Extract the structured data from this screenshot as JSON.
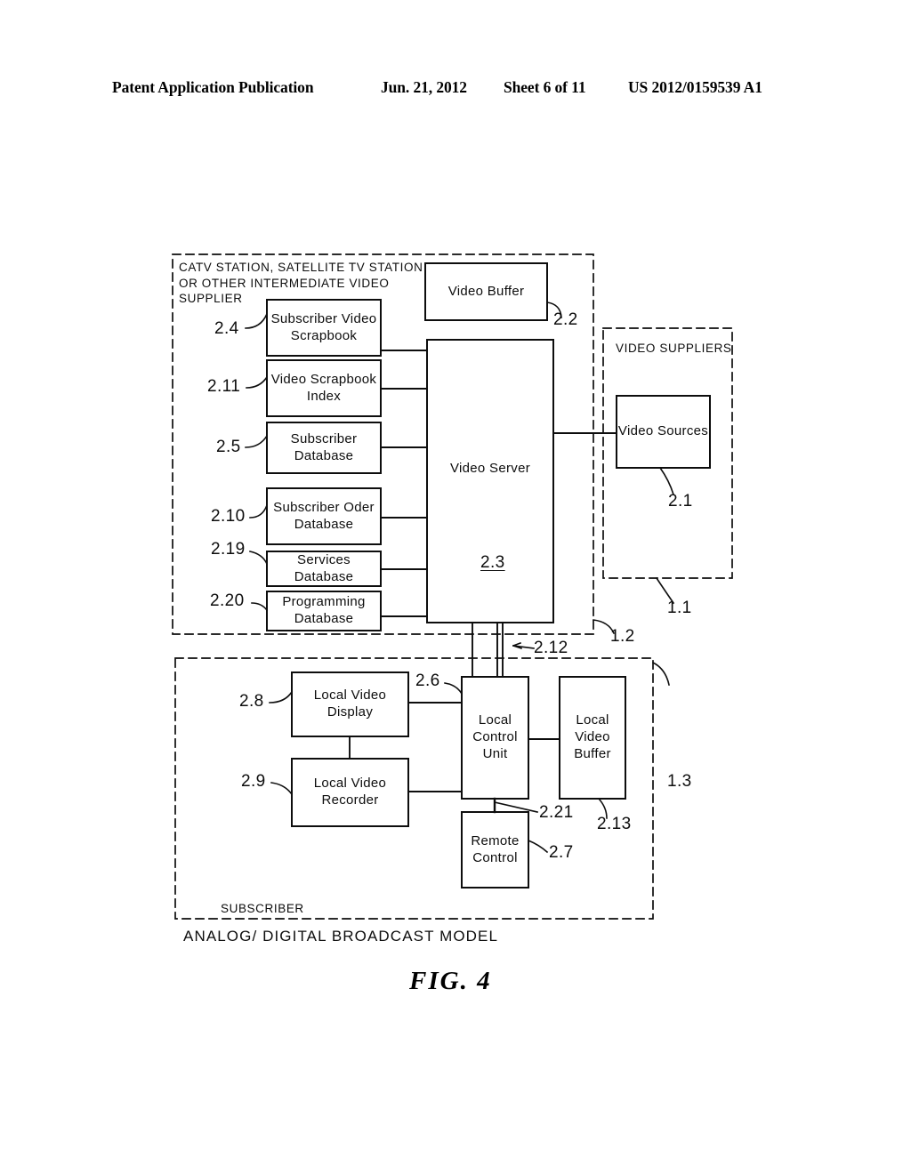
{
  "header": {
    "publication": "Patent Application Publication",
    "date": "Jun. 21, 2012",
    "sheet": "Sheet 6 of 11",
    "number": "US 2012/0159539 A1"
  },
  "figure": {
    "label": "FIG.  4",
    "caption": "ANALOG/  DIGITAL  BROADCAST  MODEL"
  },
  "zones": {
    "station": {
      "title": "CATV STATION, SATELLITE TV STATION\nOR OTHER INTERMEDIATE VIDEO SUPPLIER",
      "ref": "1.2"
    },
    "suppliers": {
      "title": "VIDEO SUPPLIERS",
      "ref": "1.1"
    },
    "subscriber": {
      "title": "SUBSCRIBER",
      "ref": "1.3"
    }
  },
  "blocks": {
    "subscriber_video_scrapbook": {
      "label": "Subscriber Video\nScrapbook",
      "ref": "2.4"
    },
    "video_scrapbook_index": {
      "label": "Video\nScrapbook\nIndex",
      "ref": "2.11"
    },
    "subscriber_database": {
      "label": "Subscriber\nDatabase",
      "ref": "2.5"
    },
    "subscriber_oder_database": {
      "label": "Subscriber Oder\nDatabase",
      "ref": "2.10"
    },
    "services_database": {
      "label": "Services Database",
      "ref": "2.19"
    },
    "programming_database": {
      "label": "Programming\nDatabase",
      "ref": "2.20"
    },
    "video_buffer": {
      "label": "Video\nBuffer",
      "ref": "2.2"
    },
    "video_server": {
      "label": "Video Server",
      "ref": "2.3"
    },
    "video_sources": {
      "label": "Video Sources",
      "ref": "2.1"
    },
    "local_video_display": {
      "label": "Local Video\nDisplay",
      "ref": "2.8"
    },
    "local_video_recorder": {
      "label": "Local Video\nRecorder",
      "ref": "2.9"
    },
    "local_control_unit": {
      "label": "Local\nControl\nUnit",
      "ref": "2.6"
    },
    "local_video_buffer": {
      "label": "Local\nVideo\nBuffer",
      "ref": "2.13"
    },
    "remote_control": {
      "label": "Remote\nControl",
      "ref": "2.7"
    }
  },
  "connections": {
    "downlink_ref": "2.12",
    "remote_link_ref": "2.21"
  },
  "colors": {
    "ink": "#0d0d0d",
    "paper": "#ffffff"
  }
}
